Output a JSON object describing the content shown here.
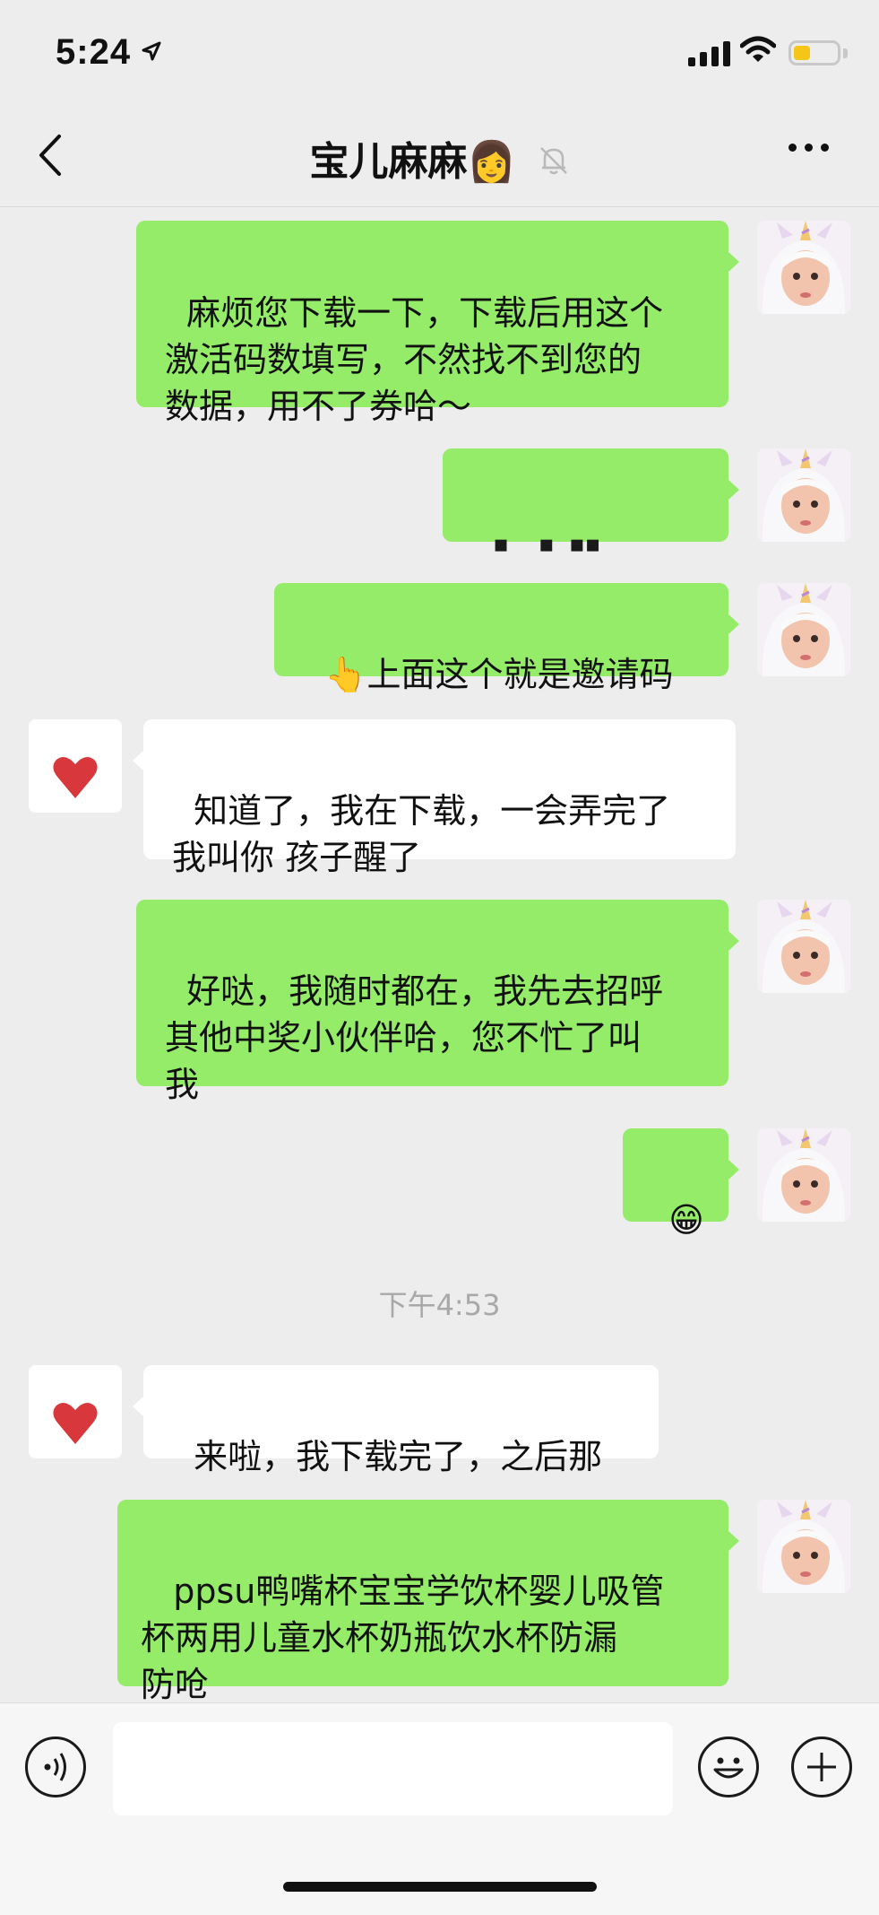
{
  "status_bar": {
    "time": "5:24",
    "signal_bars": 4,
    "battery_level": 0.3
  },
  "nav": {
    "title": "宝儿麻麻👩",
    "muted_icon": "bell-slash-icon"
  },
  "messages": [
    {
      "sender": "me",
      "text": "麻烦您下载一下，下载后用这个\n激活码数填写，不然找不到您的\n数据，用不了券哈～"
    },
    {
      "sender": "me",
      "text": "▪    ▪  ▪▪",
      "redacted": true
    },
    {
      "sender": "me",
      "text": "👆上面这个就是邀请码"
    },
    {
      "sender": "other",
      "text": "知道了，我在下载，一会弄完了\n我叫你 孩子醒了"
    },
    {
      "sender": "me",
      "text": "好哒，我随时都在，我先去招呼\n其他中奖小伙伴哈，您不忙了叫\n我"
    },
    {
      "sender": "me",
      "text": "😁"
    },
    {
      "sender": "other",
      "text": "来啦，我下载完了，之后那"
    },
    {
      "sender": "me",
      "text": " ppsu鸭嘴杯宝宝学饮杯婴儿吸管\n杯两用儿童水杯奶瓶饮水杯防漏\n防呛"
    }
  ],
  "timestamp": "下午4:53",
  "input": {
    "value": "",
    "placeholder": ""
  },
  "colors": {
    "my_bubble": "#95ec69",
    "other_bubble": "#ffffff",
    "background": "#ededed"
  }
}
